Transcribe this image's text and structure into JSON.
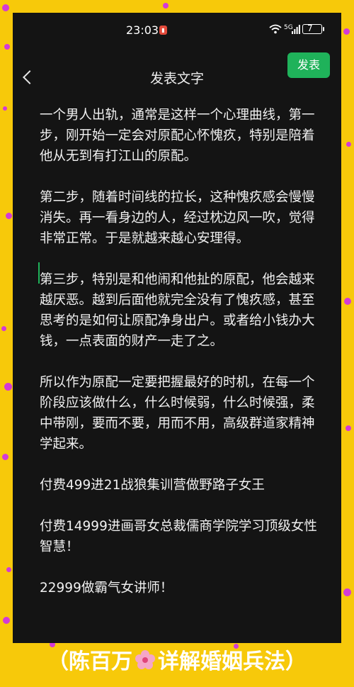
{
  "status_bar": {
    "time": "23:03",
    "network": "5G",
    "battery": "7"
  },
  "header": {
    "title": "发表文字",
    "publish_label": "发表",
    "back_icon": "chevron-left-icon"
  },
  "editor": {
    "paragraphs": [
      "一个男人出轨，通常是这样一个心理曲线，第一步，刚开始一定会对原配心怀愧疚，特别是陪着他从无到有打江山的原配。",
      "第二步，随着时间线的拉长，这种愧疚感会慢慢消失。再一看身边的人，经过枕边风一吹，觉得非常正常。于是就越来越心安理得。",
      "第三步，特别是和他闹和他扯的原配，他会越来越厌恶。越到后面他就完全没有了愧疚感，甚至思考的是如何让原配净身出户。或者给小钱办大钱，一点表面的财产一走了之。",
      "所以作为原配一定要把握最好的时机，在每一个阶段应该做什么，什么时候弱，什么时候强，柔中带刚，要而不要，用而不用，高级群道家精神学起来。",
      "付费499进21战狼集训营做野路子女王",
      "付费14999进画哥女总裁儒商学院学习顶级女性智慧！",
      "22999做霸气女讲师！"
    ]
  },
  "banner": {
    "open": "（",
    "text_left": "陈百万",
    "text_right": "详解婚姻兵法",
    "close": "）"
  },
  "colors": {
    "background": "#f7c90a",
    "accent_green": "#1fb25a",
    "dots": "#d33ad6",
    "screen": "#141414"
  }
}
